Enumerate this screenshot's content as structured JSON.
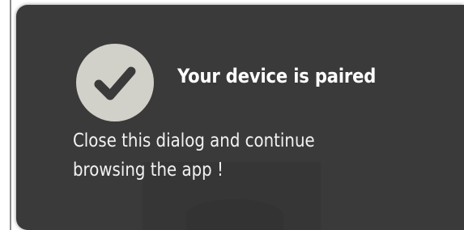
{
  "dialog": {
    "title": "Your device is paired",
    "message_line1": "Close this dialog and continue",
    "message_line2": "browsing the app !",
    "icon": "checkmark-circle-icon"
  },
  "colors": {
    "dialog_bg": "#3a3a3a",
    "badge_bg": "#d1d0c9",
    "check": "#3a3a3a",
    "text": "#ffffff"
  }
}
